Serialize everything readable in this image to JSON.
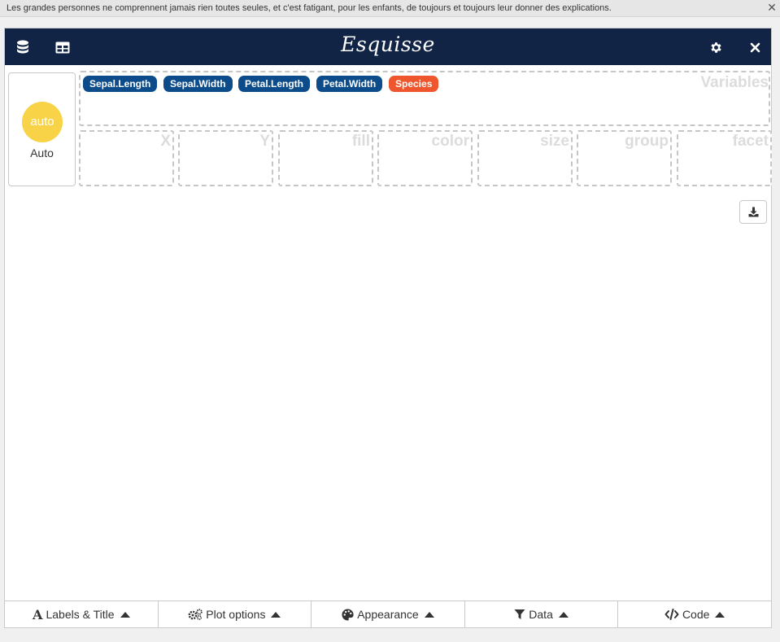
{
  "topbar": {
    "quote": "Les grandes personnes ne comprennent jamais rien toutes seules, et c'est fatigant, pour les enfants, de toujours et toujours leur donner des explications."
  },
  "header": {
    "title": "Esquisse",
    "icons": [
      "database-icon",
      "table-icon",
      "gear-icon",
      "close-icon"
    ]
  },
  "geom": {
    "circle_text": "auto",
    "label": "Auto",
    "color": "#f8d347"
  },
  "variables": {
    "title": "Variables",
    "items": [
      {
        "label": "Sepal.Length",
        "color": "#0c4c8a"
      },
      {
        "label": "Sepal.Width",
        "color": "#0c4c8a"
      },
      {
        "label": "Petal.Length",
        "color": "#0c4c8a"
      },
      {
        "label": "Petal.Width",
        "color": "#0c4c8a"
      },
      {
        "label": "Species",
        "color": "#ef562d"
      }
    ]
  },
  "aesthetics": [
    "X",
    "Y",
    "fill",
    "color",
    "size",
    "group",
    "facet"
  ],
  "bottom": {
    "labels_title": "Labels & Title",
    "plot_options": "Plot options",
    "appearance": "Appearance",
    "data": "Data",
    "code": "Code"
  },
  "colors": {
    "header_bg": "#112446",
    "numeric_var": "#0c4c8a",
    "factor_var": "#ef562d"
  }
}
